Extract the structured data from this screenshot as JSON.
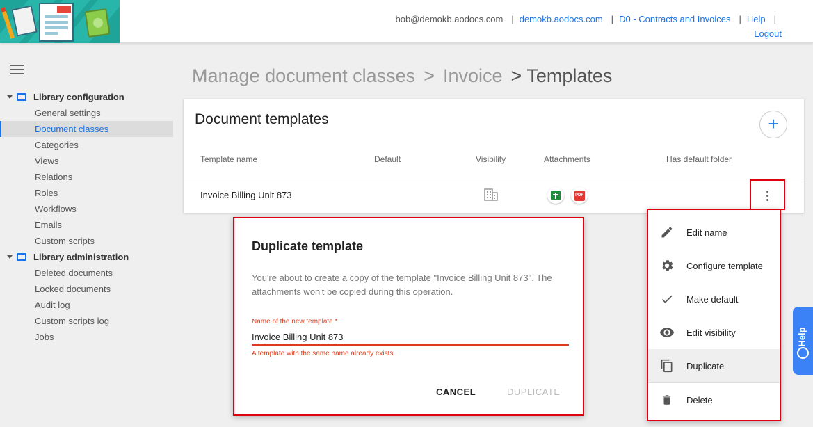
{
  "header": {
    "user_email": "bob@demokb.aodocs.com",
    "domain": "demokb.aodocs.com",
    "library": "D0 - Contracts and Invoices",
    "help": "Help",
    "logout": "Logout"
  },
  "sidebar": {
    "sections": [
      {
        "title": "Library configuration",
        "items": [
          "General settings",
          "Document classes",
          "Categories",
          "Views",
          "Relations",
          "Roles",
          "Workflows",
          "Emails",
          "Custom scripts"
        ],
        "active": "Document classes"
      },
      {
        "title": "Library administration",
        "items": [
          "Deleted documents",
          "Locked documents",
          "Audit log",
          "Custom scripts log",
          "Jobs"
        ]
      }
    ]
  },
  "breadcrumb": {
    "root": "Manage document classes",
    "sep": ">",
    "middle": "Invoice",
    "current": "Templates"
  },
  "card": {
    "title": "Document templates",
    "add_label": "+",
    "columns": [
      "Template name",
      "Default",
      "Visibility",
      "Attachments",
      "Has default folder"
    ],
    "row": {
      "name": "Invoice Billing Unit 873",
      "visibility_icon": "domain-building-icon",
      "attachments": [
        "google-sheets-icon",
        "pdf-icon"
      ],
      "pdf_label": "PDF"
    }
  },
  "dialog": {
    "title": "Duplicate template",
    "message": "You're about to create a copy of the template \"Invoice Billing Unit 873\". The attachments won't be copied during this operation.",
    "field_label": "Name of the new template *",
    "field_value": "Invoice Billing Unit 873",
    "field_error": "A template with the same name already exists",
    "cancel": "CANCEL",
    "duplicate": "DUPLICATE"
  },
  "menu": {
    "items": [
      {
        "label": "Edit name",
        "icon": "pencil-icon"
      },
      {
        "label": "Configure template",
        "icon": "gear-icon"
      },
      {
        "label": "Make default",
        "icon": "check-icon"
      },
      {
        "label": "Edit visibility",
        "icon": "eye-icon"
      },
      {
        "label": "Duplicate",
        "icon": "copy-icon"
      },
      {
        "label": "Delete",
        "icon": "trash-icon"
      }
    ]
  },
  "help_tab": {
    "label": "Help"
  },
  "colors": {
    "accent": "#1a73e8",
    "error": "#e03a1e",
    "highlight_border": "#e0000f",
    "logo_bg": "#1fa49a"
  }
}
